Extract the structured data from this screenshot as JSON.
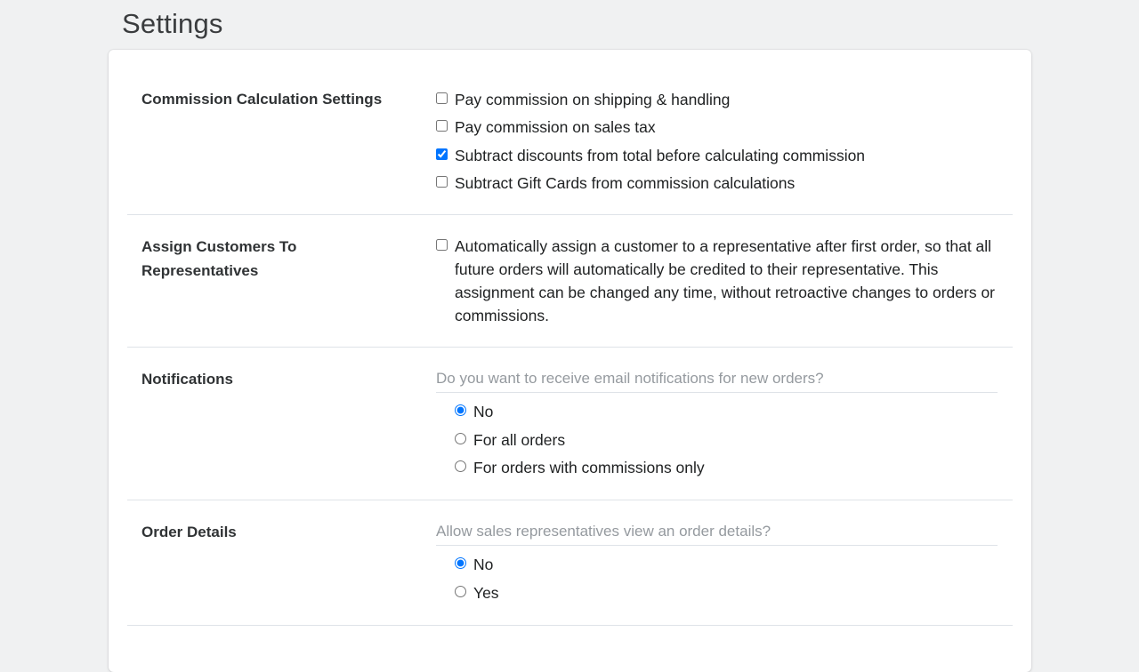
{
  "page": {
    "title": "Settings"
  },
  "commission": {
    "title": "Commission Calculation Settings",
    "options": [
      {
        "label": "Pay commission on shipping & handling",
        "checked": false
      },
      {
        "label": "Pay commission on sales tax",
        "checked": false
      },
      {
        "label": "Subtract discounts from total before calculating commission",
        "checked": true
      },
      {
        "label": "Subtract Gift Cards from commission calculations",
        "checked": false
      }
    ]
  },
  "assign": {
    "title": "Assign Customers To Representatives",
    "option": {
      "label": "Automatically assign a customer to a representative after first order, so that all future orders will automatically be credited to their representative. This assignment can be changed any time, without retroactive changes to orders or commissions.",
      "checked": false
    }
  },
  "notifications": {
    "title": "Notifications",
    "question": "Do you want to receive email notifications for new orders?",
    "options": [
      {
        "label": "No",
        "selected": true
      },
      {
        "label": "For all orders",
        "selected": false
      },
      {
        "label": "For orders with commissions only",
        "selected": false
      }
    ]
  },
  "order_details": {
    "title": "Order Details",
    "question": "Allow sales representatives view an order details?",
    "options": [
      {
        "label": "No",
        "selected": true
      },
      {
        "label": "Yes",
        "selected": false
      }
    ]
  }
}
